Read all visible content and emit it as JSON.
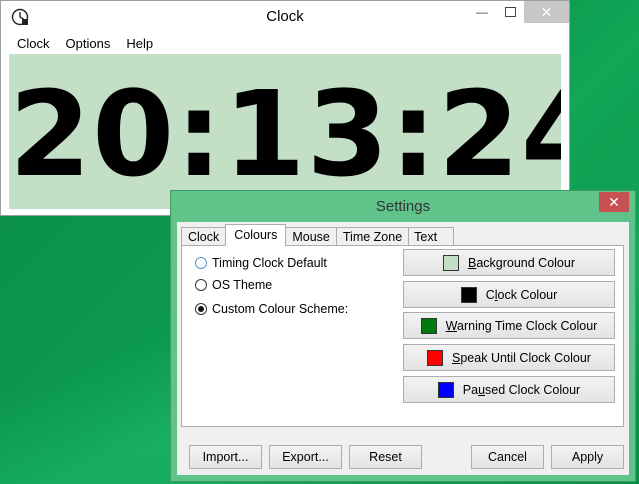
{
  "clock_window": {
    "title": "Clock",
    "menu": [
      "Clock",
      "Options",
      "Help"
    ],
    "time": "20:13:24",
    "background_color": "#c3dfc5",
    "text_color": "#000000"
  },
  "settings": {
    "title": "Settings",
    "tabs": [
      {
        "label": "Clock",
        "active": false
      },
      {
        "label": "Colours",
        "active": true
      },
      {
        "label": "Mouse",
        "active": false
      },
      {
        "label": "Time Zone",
        "active": false
      },
      {
        "label": "Text",
        "active": false
      }
    ],
    "radios": [
      {
        "label": "Timing Clock Default",
        "checked": false
      },
      {
        "label": "OS Theme",
        "checked": false
      },
      {
        "label": "Custom Colour Scheme:",
        "checked": true
      }
    ],
    "colour_buttons": [
      {
        "accel": "B",
        "rest": "ackground Colour",
        "color": "#c3dfc5"
      },
      {
        "pre": "C",
        "accel": "l",
        "rest": "ock Colour",
        "color": "#000000"
      },
      {
        "accel": "W",
        "rest": "arning Time Clock Colour",
        "color": "#007b0c"
      },
      {
        "accel": "S",
        "rest": "peak Until Clock Colour",
        "color": "#ff0000"
      },
      {
        "pre": "Pa",
        "accel": "u",
        "rest": "sed Clock Colour",
        "color": "#0000ff"
      }
    ],
    "buttons": {
      "import": "Import...",
      "export": "Export...",
      "reset": "Reset",
      "cancel": "Cancel",
      "apply": "Apply"
    }
  }
}
